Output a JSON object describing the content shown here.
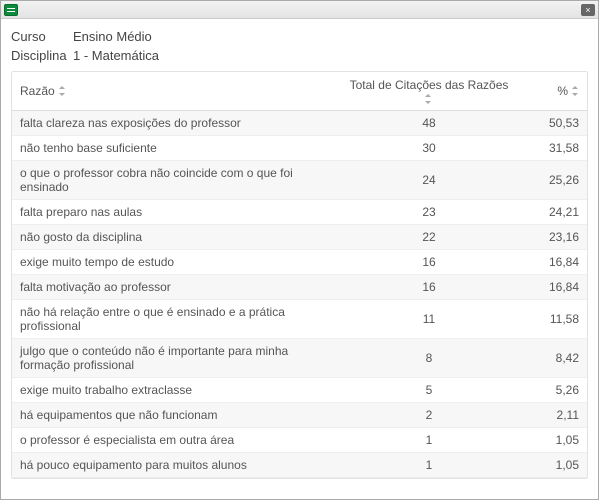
{
  "titlebar": {
    "icon": "report-icon",
    "close_label": "×"
  },
  "header": {
    "curso_label": "Curso",
    "curso_value": "Ensino Médio",
    "disciplina_label": "Disciplina",
    "disciplina_value": "1 - Matemática"
  },
  "table": {
    "columns": {
      "razao": "Razão",
      "count": "Total de Citações das Razões",
      "pct": "%"
    },
    "rows": [
      {
        "razao": "falta clareza nas exposições do professor",
        "count": "48",
        "pct": "50,53"
      },
      {
        "razao": "não tenho base suficiente",
        "count": "30",
        "pct": "31,58"
      },
      {
        "razao": "o que o professor cobra não coincide com o que foi ensinado",
        "count": "24",
        "pct": "25,26"
      },
      {
        "razao": "falta preparo nas aulas",
        "count": "23",
        "pct": "24,21"
      },
      {
        "razao": "não gosto da disciplina",
        "count": "22",
        "pct": "23,16"
      },
      {
        "razao": "exige muito tempo de estudo",
        "count": "16",
        "pct": "16,84"
      },
      {
        "razao": "falta motivação ao professor",
        "count": "16",
        "pct": "16,84"
      },
      {
        "razao": "não há relação entre o que é ensinado e a prática profissional",
        "count": "11",
        "pct": "11,58"
      },
      {
        "razao": "julgo que o conteúdo não é importante para minha formação profissional",
        "count": "8",
        "pct": "8,42"
      },
      {
        "razao": "exige muito trabalho extraclasse",
        "count": "5",
        "pct": "5,26"
      },
      {
        "razao": "há equipamentos que não funcionam",
        "count": "2",
        "pct": "2,11"
      },
      {
        "razao": "o professor é especialista em outra área",
        "count": "1",
        "pct": "1,05"
      },
      {
        "razao": "há pouco equipamento para muitos alunos",
        "count": "1",
        "pct": "1,05"
      }
    ]
  }
}
